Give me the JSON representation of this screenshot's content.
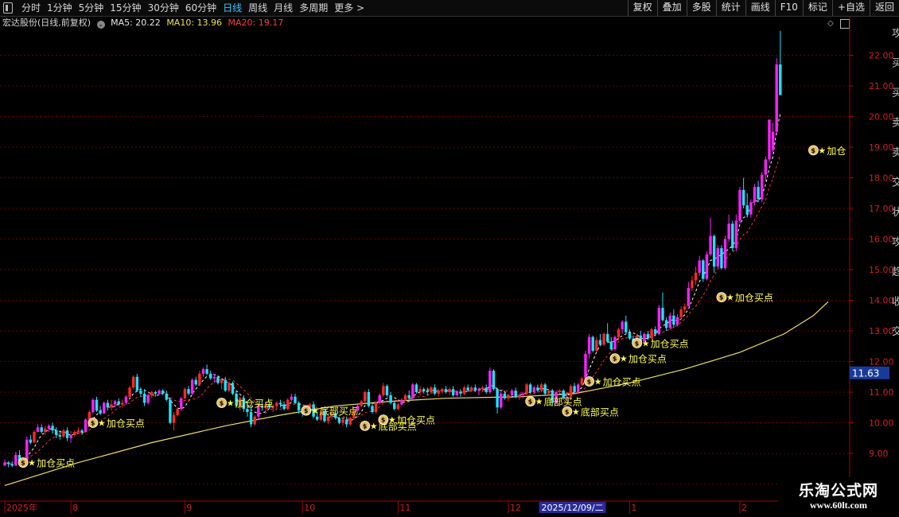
{
  "toolbar": {
    "tabs": [
      "分时",
      "1分钟",
      "5分钟",
      "15分钟",
      "30分钟",
      "60分钟",
      "日线",
      "周线",
      "月线",
      "多周期",
      "更多 >"
    ],
    "active_tab": "日线",
    "tools": [
      "复权",
      "叠加",
      "多股",
      "统计",
      "画线",
      "F10",
      "标记",
      "+自选",
      "返回"
    ]
  },
  "info": {
    "stock": "宏达股份(日线,前复权)",
    "ma5": "MA5: 20.22",
    "ma10": "MA10: 13.96",
    "ma20": "MA20: 19.17"
  },
  "price_tag": "11.63",
  "right_side_labels": [
    "攻",
    "买",
    "买",
    "卖",
    "卖",
    "交",
    "状",
    "攻",
    "趋",
    "收",
    "交"
  ],
  "watermark": {
    "title": "乐淘公式网",
    "url": "www.60lt.com"
  },
  "colors": {
    "up_magenta": "#ff20ff",
    "up_red": "#ff2828",
    "down_cyan": "#20e0ff",
    "neutral_yellow": "#ffff40",
    "long_ma": "#f0e060",
    "signal": "#ffff50"
  },
  "chart_data": {
    "type": "candlestick",
    "y_ticks": [
      8.0,
      9.0,
      10.0,
      11.0,
      12.0,
      13.0,
      14.0,
      15.0,
      16.0,
      17.0,
      18.0,
      19.0,
      20.0,
      21.0,
      22.0
    ],
    "ylim": [
      7.7,
      22.9
    ],
    "x_labels": [
      {
        "label": "2025年",
        "i": 0
      },
      {
        "label": "8",
        "i": 18
      },
      {
        "label": "9",
        "i": 49
      },
      {
        "label": "10",
        "i": 81
      },
      {
        "label": "11",
        "i": 107
      },
      {
        "label": "12",
        "i": 137
      },
      {
        "label": "2025/12/09/二",
        "i": 146,
        "highlight": true
      },
      {
        "label": "1",
        "i": 170
      },
      {
        "label": "2",
        "i": 200
      }
    ],
    "signals": [
      {
        "i": 5,
        "price": 8.7,
        "text": "加仓买点"
      },
      {
        "i": 24,
        "price": 10.0,
        "text": "加仓买点"
      },
      {
        "i": 59,
        "price": 10.65,
        "text": "加仓买点"
      },
      {
        "i": 82,
        "price": 10.4,
        "text": "底部买点"
      },
      {
        "i": 98,
        "price": 9.9,
        "text": "底部买点"
      },
      {
        "i": 103,
        "price": 10.1,
        "text": "加仓买点"
      },
      {
        "i": 143,
        "price": 10.7,
        "text": "底部买点"
      },
      {
        "i": 153,
        "price": 10.37,
        "text": "底部买点"
      },
      {
        "i": 159,
        "price": 11.35,
        "text": "加仓买点"
      },
      {
        "i": 166,
        "price": 12.1,
        "text": "加仓买点"
      },
      {
        "i": 172,
        "price": 12.6,
        "text": "加仓买点"
      },
      {
        "i": 195,
        "price": 14.1,
        "text": "加仓买点"
      },
      {
        "i": 220,
        "price": 18.9,
        "text": "加仓"
      }
    ],
    "long_ma": [
      {
        "i": 0,
        "v": 7.95
      },
      {
        "i": 20,
        "v": 8.7
      },
      {
        "i": 40,
        "v": 9.35
      },
      {
        "i": 60,
        "v": 9.9
      },
      {
        "i": 75,
        "v": 10.25
      },
      {
        "i": 90,
        "v": 10.55
      },
      {
        "i": 105,
        "v": 10.7
      },
      {
        "i": 120,
        "v": 10.8
      },
      {
        "i": 140,
        "v": 10.85
      },
      {
        "i": 155,
        "v": 10.95
      },
      {
        "i": 170,
        "v": 11.3
      },
      {
        "i": 185,
        "v": 11.75
      },
      {
        "i": 200,
        "v": 12.3
      },
      {
        "i": 212,
        "v": 12.9
      },
      {
        "i": 220,
        "v": 13.5
      },
      {
        "i": 224,
        "v": 13.95
      }
    ],
    "candles_ohlc": [
      [
        8.6,
        8.8,
        8.6,
        8.7
      ],
      [
        8.7,
        8.75,
        8.55,
        8.65
      ],
      [
        8.65,
        8.75,
        8.55,
        8.6
      ],
      [
        8.6,
        9.05,
        8.6,
        8.95
      ],
      [
        8.95,
        9.1,
        8.75,
        8.75
      ],
      [
        8.7,
        8.8,
        8.55,
        8.7
      ],
      [
        8.75,
        9.55,
        8.7,
        9.45
      ],
      [
        9.45,
        9.6,
        9.3,
        9.35
      ],
      [
        9.35,
        9.75,
        9.35,
        9.7
      ],
      [
        9.7,
        9.95,
        9.7,
        9.85
      ],
      [
        9.85,
        9.95,
        9.65,
        9.7
      ],
      [
        9.7,
        9.9,
        9.6,
        9.8
      ],
      [
        9.8,
        9.95,
        9.7,
        9.9
      ],
      [
        9.9,
        10.0,
        9.65,
        9.75
      ],
      [
        9.75,
        9.85,
        9.5,
        9.6
      ],
      [
        9.6,
        9.7,
        9.45,
        9.55
      ],
      [
        9.55,
        9.8,
        9.5,
        9.75
      ],
      [
        9.75,
        9.85,
        9.4,
        9.5
      ],
      [
        9.5,
        9.65,
        9.35,
        9.6
      ],
      [
        9.6,
        9.75,
        9.55,
        9.7
      ],
      [
        9.7,
        9.85,
        9.65,
        9.75
      ],
      [
        9.75,
        9.8,
        9.6,
        9.7
      ],
      [
        9.7,
        10.15,
        9.7,
        10.1
      ],
      [
        10.1,
        10.4,
        10.0,
        10.35
      ],
      [
        10.35,
        10.8,
        10.3,
        10.75
      ],
      [
        10.75,
        10.85,
        10.35,
        10.4
      ],
      [
        10.4,
        10.55,
        10.25,
        10.3
      ],
      [
        10.3,
        10.7,
        10.3,
        10.65
      ],
      [
        10.65,
        10.75,
        10.4,
        10.5
      ],
      [
        10.5,
        10.75,
        10.4,
        10.6
      ],
      [
        10.6,
        10.75,
        10.5,
        10.7
      ],
      [
        10.7,
        10.8,
        10.55,
        10.6
      ],
      [
        10.6,
        10.75,
        10.5,
        10.65
      ],
      [
        10.65,
        10.9,
        10.6,
        10.85
      ],
      [
        10.85,
        11.2,
        10.8,
        11.15
      ],
      [
        11.15,
        11.55,
        11.1,
        11.5
      ],
      [
        11.5,
        11.6,
        11.0,
        11.05
      ],
      [
        11.05,
        11.15,
        10.85,
        10.95
      ],
      [
        10.95,
        11.1,
        10.55,
        10.65
      ],
      [
        10.65,
        10.95,
        10.6,
        10.9
      ],
      [
        10.9,
        11.05,
        10.8,
        11.0
      ],
      [
        11.0,
        11.05,
        10.85,
        10.95
      ],
      [
        10.95,
        11.1,
        10.9,
        11.05
      ],
      [
        11.05,
        11.1,
        10.9,
        10.95
      ],
      [
        10.95,
        11.05,
        10.7,
        10.75
      ],
      [
        10.75,
        10.8,
        9.95,
        10.0
      ],
      [
        10.0,
        10.35,
        9.75,
        10.25
      ],
      [
        10.25,
        10.5,
        10.2,
        10.45
      ],
      [
        10.45,
        10.85,
        10.4,
        10.8
      ],
      [
        10.8,
        11.15,
        10.75,
        11.1
      ],
      [
        11.1,
        11.2,
        10.9,
        10.95
      ],
      [
        10.95,
        11.45,
        10.9,
        11.4
      ],
      [
        11.4,
        11.5,
        11.2,
        11.25
      ],
      [
        11.25,
        11.7,
        11.2,
        11.6
      ],
      [
        11.6,
        11.8,
        11.5,
        11.75
      ],
      [
        11.75,
        11.9,
        11.55,
        11.6
      ],
      [
        11.6,
        11.7,
        11.4,
        11.45
      ],
      [
        11.45,
        11.6,
        11.3,
        11.5
      ],
      [
        11.5,
        11.55,
        11.25,
        11.3
      ],
      [
        11.3,
        11.45,
        11.1,
        11.4
      ],
      [
        11.4,
        11.5,
        11.0,
        11.05
      ],
      [
        11.05,
        11.35,
        11.0,
        11.3
      ],
      [
        11.3,
        11.35,
        10.9,
        10.95
      ],
      [
        10.95,
        11.05,
        10.5,
        10.55
      ],
      [
        10.55,
        10.85,
        10.4,
        10.8
      ],
      [
        10.8,
        10.9,
        10.35,
        10.45
      ],
      [
        10.45,
        10.6,
        10.2,
        10.35
      ],
      [
        10.35,
        10.55,
        9.85,
        9.95
      ],
      [
        9.95,
        10.25,
        9.9,
        10.2
      ],
      [
        10.2,
        10.6,
        10.1,
        10.55
      ],
      [
        10.55,
        10.7,
        10.4,
        10.5
      ],
      [
        10.5,
        10.65,
        10.3,
        10.6
      ],
      [
        10.6,
        10.7,
        10.45,
        10.5
      ],
      [
        10.5,
        10.6,
        10.35,
        10.55
      ],
      [
        10.55,
        10.7,
        10.45,
        10.65
      ],
      [
        10.65,
        10.75,
        10.5,
        10.6
      ],
      [
        10.6,
        10.7,
        10.4,
        10.45
      ],
      [
        10.45,
        10.8,
        10.4,
        10.75
      ],
      [
        10.75,
        10.95,
        10.7,
        10.85
      ],
      [
        10.85,
        10.95,
        10.6,
        10.65
      ],
      [
        10.65,
        10.7,
        10.3,
        10.4
      ],
      [
        10.4,
        10.5,
        10.2,
        10.3
      ],
      [
        10.3,
        10.6,
        10.25,
        10.5
      ],
      [
        10.5,
        10.65,
        10.4,
        10.6
      ],
      [
        10.6,
        10.7,
        10.15,
        10.2
      ],
      [
        10.2,
        10.35,
        10.05,
        10.1
      ],
      [
        10.1,
        10.4,
        10.05,
        10.35
      ],
      [
        10.35,
        10.45,
        10.0,
        10.05
      ],
      [
        10.05,
        10.25,
        9.95,
        10.2
      ],
      [
        10.2,
        10.35,
        10.1,
        10.3
      ],
      [
        10.3,
        10.4,
        10.1,
        10.15
      ],
      [
        10.15,
        10.2,
        9.95,
        10.0
      ],
      [
        10.0,
        10.15,
        9.9,
        10.1
      ],
      [
        10.1,
        10.2,
        9.85,
        9.95
      ],
      [
        9.95,
        10.2,
        9.9,
        10.15
      ],
      [
        10.15,
        10.45,
        10.1,
        10.4
      ],
      [
        10.4,
        10.6,
        10.3,
        10.55
      ],
      [
        10.55,
        10.75,
        10.5,
        10.7
      ],
      [
        10.7,
        11.05,
        10.65,
        11.0
      ],
      [
        11.0,
        11.1,
        10.5,
        10.55
      ],
      [
        10.55,
        10.6,
        10.3,
        10.35
      ],
      [
        10.35,
        10.7,
        10.3,
        10.65
      ],
      [
        10.65,
        10.95,
        10.6,
        10.9
      ],
      [
        10.9,
        11.3,
        10.85,
        11.2
      ],
      [
        11.2,
        11.25,
        10.85,
        10.9
      ],
      [
        10.9,
        11.0,
        10.6,
        10.65
      ],
      [
        10.65,
        10.7,
        10.4,
        10.45
      ],
      [
        10.45,
        10.65,
        10.4,
        10.6
      ],
      [
        10.6,
        10.8,
        10.55,
        10.75
      ],
      [
        10.75,
        10.95,
        10.7,
        10.9
      ],
      [
        10.9,
        11.05,
        10.75,
        10.8
      ],
      [
        10.8,
        11.3,
        10.75,
        11.25
      ],
      [
        11.25,
        11.3,
        10.95,
        11.0
      ],
      [
        11.0,
        11.2,
        10.9,
        11.1
      ],
      [
        11.1,
        11.15,
        10.95,
        11.05
      ],
      [
        11.05,
        11.15,
        10.9,
        11.0
      ],
      [
        11.0,
        11.2,
        10.95,
        11.15
      ],
      [
        11.15,
        11.25,
        10.9,
        10.95
      ],
      [
        10.95,
        11.1,
        10.85,
        11.05
      ],
      [
        11.05,
        11.15,
        10.95,
        11.1
      ],
      [
        11.1,
        11.2,
        10.95,
        11.0
      ],
      [
        11.0,
        11.15,
        10.9,
        11.1
      ],
      [
        11.1,
        11.2,
        10.85,
        10.9
      ],
      [
        10.9,
        11.05,
        10.85,
        11.0
      ],
      [
        11.0,
        11.1,
        10.85,
        10.95
      ],
      [
        10.95,
        11.2,
        10.9,
        11.15
      ],
      [
        11.15,
        11.25,
        11.0,
        11.05
      ],
      [
        11.05,
        11.2,
        11.0,
        11.15
      ],
      [
        11.15,
        11.25,
        11.0,
        11.05
      ],
      [
        11.05,
        11.15,
        10.9,
        11.1
      ],
      [
        11.1,
        11.2,
        11.0,
        11.15
      ],
      [
        11.15,
        11.25,
        10.95,
        11.0
      ],
      [
        11.0,
        11.8,
        10.95,
        11.7
      ],
      [
        11.7,
        11.75,
        11.05,
        11.1
      ],
      [
        11.1,
        11.15,
        10.3,
        10.5
      ],
      [
        10.5,
        11.0,
        10.45,
        10.95
      ],
      [
        10.95,
        11.05,
        10.75,
        10.8
      ],
      [
        10.8,
        10.95,
        10.7,
        10.9
      ],
      [
        10.9,
        11.1,
        10.85,
        11.05
      ],
      [
        11.05,
        11.15,
        10.8,
        10.85
      ],
      [
        10.85,
        10.95,
        10.75,
        10.9
      ],
      [
        10.9,
        11.0,
        10.8,
        10.95
      ],
      [
        10.95,
        11.3,
        10.9,
        11.25
      ],
      [
        11.25,
        11.3,
        10.95,
        11.0
      ],
      [
        11.0,
        11.2,
        10.95,
        11.15
      ],
      [
        11.15,
        11.25,
        11.0,
        11.05
      ],
      [
        11.05,
        11.3,
        11.0,
        11.25
      ],
      [
        11.25,
        11.3,
        10.9,
        10.95
      ],
      [
        10.95,
        11.1,
        10.9,
        11.05
      ],
      [
        11.05,
        11.1,
        10.6,
        10.65
      ],
      [
        10.65,
        11.05,
        10.6,
        11.0
      ],
      [
        11.0,
        11.1,
        10.95,
        11.05
      ],
      [
        11.05,
        11.1,
        10.75,
        10.8
      ],
      [
        10.8,
        10.9,
        10.65,
        10.85
      ],
      [
        10.85,
        11.25,
        10.8,
        11.2
      ],
      [
        11.2,
        11.3,
        10.95,
        11.0
      ],
      [
        11.0,
        11.3,
        10.95,
        11.25
      ],
      [
        11.25,
        11.5,
        11.2,
        11.45
      ],
      [
        11.45,
        12.35,
        11.4,
        12.25
      ],
      [
        12.25,
        12.9,
        12.1,
        12.8
      ],
      [
        12.8,
        12.85,
        12.3,
        12.35
      ],
      [
        12.35,
        12.8,
        12.3,
        12.7
      ],
      [
        12.7,
        12.9,
        12.5,
        12.55
      ],
      [
        12.55,
        12.95,
        12.5,
        12.9
      ],
      [
        12.9,
        13.25,
        12.6,
        12.65
      ],
      [
        12.65,
        12.8,
        12.35,
        12.4
      ],
      [
        12.4,
        12.85,
        12.35,
        12.8
      ],
      [
        12.8,
        13.1,
        12.7,
        13.05
      ],
      [
        13.05,
        13.35,
        12.9,
        13.3
      ],
      [
        13.3,
        13.5,
        12.9,
        12.95
      ],
      [
        12.95,
        13.05,
        12.7,
        12.75
      ],
      [
        12.75,
        12.85,
        12.55,
        12.6
      ],
      [
        12.6,
        12.9,
        12.5,
        12.85
      ],
      [
        12.85,
        13.0,
        12.6,
        12.65
      ],
      [
        12.65,
        12.95,
        12.6,
        12.9
      ],
      [
        12.9,
        13.0,
        12.7,
        12.75
      ],
      [
        12.75,
        13.1,
        12.7,
        13.05
      ],
      [
        13.05,
        13.15,
        12.85,
        12.9
      ],
      [
        12.9,
        13.85,
        12.85,
        13.75
      ],
      [
        13.75,
        14.25,
        13.3,
        13.35
      ],
      [
        13.35,
        13.45,
        13.0,
        13.1
      ],
      [
        13.1,
        13.6,
        13.05,
        13.5
      ],
      [
        13.5,
        13.7,
        13.1,
        13.2
      ],
      [
        13.2,
        13.55,
        13.15,
        13.45
      ],
      [
        13.45,
        13.8,
        13.35,
        13.7
      ],
      [
        13.7,
        13.9,
        13.6,
        13.8
      ],
      [
        13.8,
        14.6,
        13.8,
        14.4
      ],
      [
        14.4,
        14.8,
        14.3,
        14.65
      ],
      [
        14.65,
        15.1,
        14.5,
        14.9
      ],
      [
        14.9,
        15.45,
        14.8,
        15.3
      ],
      [
        15.3,
        15.35,
        14.6,
        14.7
      ],
      [
        14.7,
        15.6,
        14.65,
        15.5
      ],
      [
        15.5,
        16.7,
        15.45,
        16.1
      ],
      [
        16.1,
        16.15,
        14.9,
        15.1
      ],
      [
        15.1,
        15.8,
        15.05,
        15.7
      ],
      [
        15.7,
        15.8,
        15.0,
        15.05
      ],
      [
        15.05,
        16.1,
        15.0,
        16.0
      ],
      [
        16.0,
        16.8,
        15.9,
        16.5
      ],
      [
        16.5,
        16.6,
        15.6,
        15.7
      ],
      [
        15.7,
        16.8,
        15.6,
        16.6
      ],
      [
        16.6,
        17.7,
        16.5,
        17.6
      ],
      [
        17.6,
        18.0,
        17.0,
        17.1
      ],
      [
        17.1,
        17.5,
        16.7,
        16.8
      ],
      [
        16.8,
        17.3,
        16.7,
        17.2
      ],
      [
        17.2,
        17.8,
        17.1,
        17.7
      ],
      [
        17.7,
        17.9,
        17.2,
        17.3
      ],
      [
        17.3,
        18.2,
        17.2,
        18.1
      ],
      [
        18.1,
        18.7,
        17.9,
        18.6
      ],
      [
        18.6,
        19.9,
        18.5,
        19.9
      ],
      [
        18.9,
        19.8,
        18.8,
        19.5
      ],
      [
        19.5,
        21.9,
        19.4,
        21.7
      ],
      [
        21.7,
        22.8,
        20.7,
        20.7
      ]
    ]
  }
}
